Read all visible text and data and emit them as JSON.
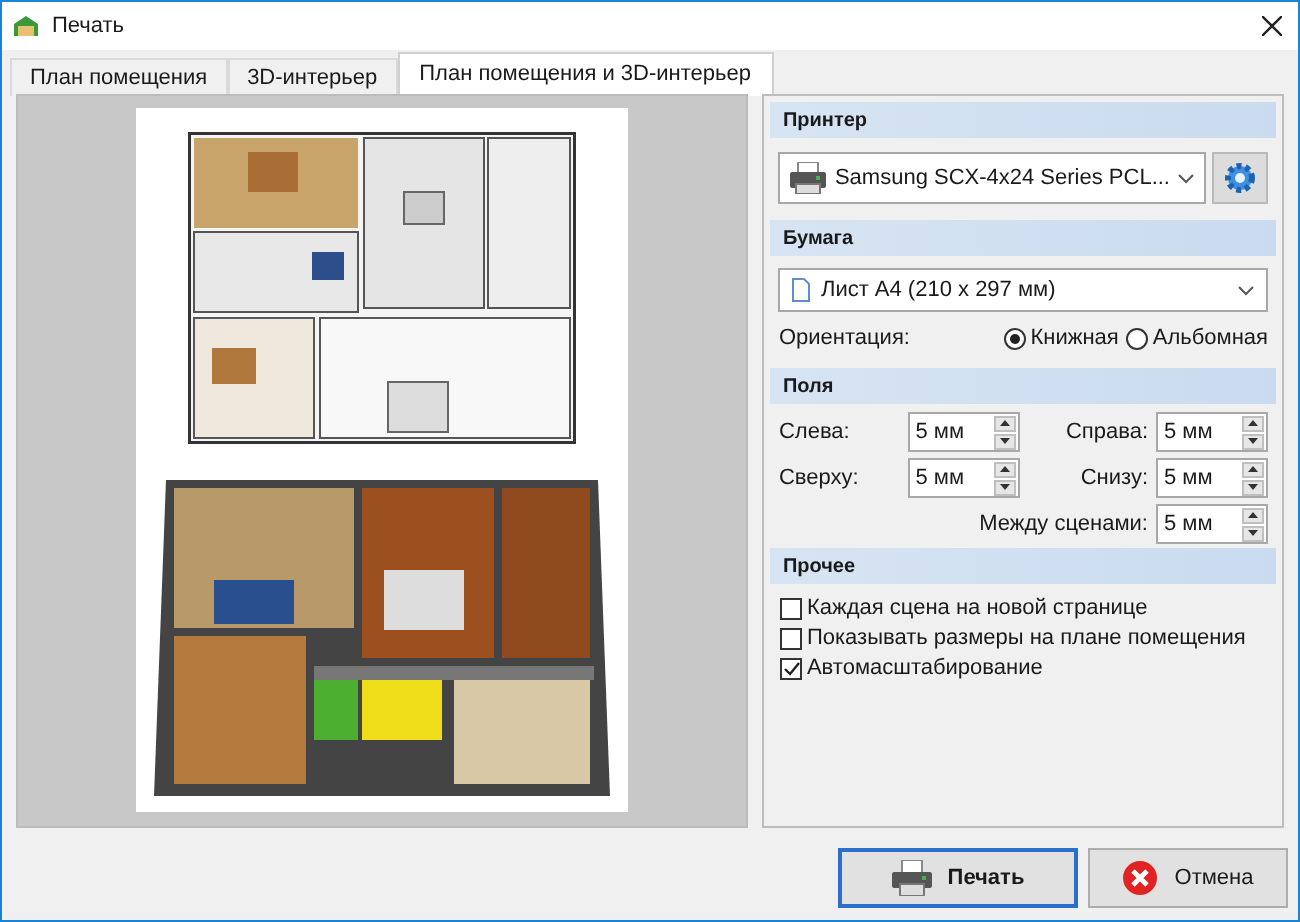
{
  "window": {
    "title": "Печать"
  },
  "tabs": [
    {
      "label": "План помещения",
      "selected": false
    },
    {
      "label": "3D-интерьер",
      "selected": false
    },
    {
      "label": "План помещения и 3D-интерьер",
      "selected": true
    }
  ],
  "printer": {
    "header": "Принтер",
    "value": "Samsung SCX-4x24 Series PCL..."
  },
  "paper": {
    "header": "Бумага",
    "value": "Лист A4 (210 x 297 мм)",
    "orientation_label": "Ориентация:",
    "orientations": [
      {
        "label": "Книжная",
        "selected": true
      },
      {
        "label": "Альбомная",
        "selected": false
      }
    ]
  },
  "margins": {
    "header": "Поля",
    "fields": [
      {
        "label": "Слева:",
        "value": "5 мм"
      },
      {
        "label": "Справа:",
        "value": "5 мм"
      },
      {
        "label": "Сверху:",
        "value": "5 мм"
      },
      {
        "label": "Снизу:",
        "value": "5 мм"
      },
      {
        "label": "Между сценами:",
        "value": "5 мм"
      }
    ]
  },
  "other": {
    "header": "Прочее",
    "options": [
      {
        "label": "Каждая сцена на новой странице",
        "checked": false
      },
      {
        "label": "Показывать размеры на плане помещения",
        "checked": false
      },
      {
        "label": "Автомасштабирование",
        "checked": true
      }
    ]
  },
  "buttons": [
    {
      "kind": "print",
      "label": "Печать"
    },
    {
      "kind": "cancel",
      "label": "Отмена"
    }
  ]
}
